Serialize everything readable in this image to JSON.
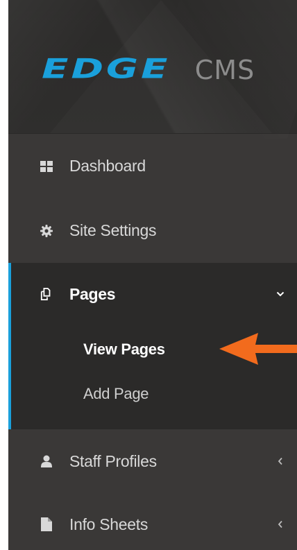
{
  "brand": {
    "logo_primary": "EDGE",
    "logo_secondary": "CMS",
    "accent_color": "#1aa0db"
  },
  "nav": {
    "items": [
      {
        "label": "Dashboard",
        "icon": "dashboard-grid-icon"
      },
      {
        "label": "Site Settings",
        "icon": "gear-icon"
      },
      {
        "label": "Pages",
        "icon": "pages-copy-icon",
        "expanded": true,
        "chevron": "chevron-down-icon"
      },
      {
        "label": "Staff Profiles",
        "icon": "user-icon",
        "chevron": "chevron-left-icon"
      },
      {
        "label": "Info Sheets",
        "icon": "file-icon",
        "chevron": "chevron-left-icon"
      }
    ],
    "pages_submenu": [
      {
        "label": "View Pages",
        "active": true
      },
      {
        "label": "Add Page"
      }
    ]
  },
  "annotation": {
    "arrow_color": "#f26b1d",
    "arrow_icon": "arrow-left-icon"
  }
}
